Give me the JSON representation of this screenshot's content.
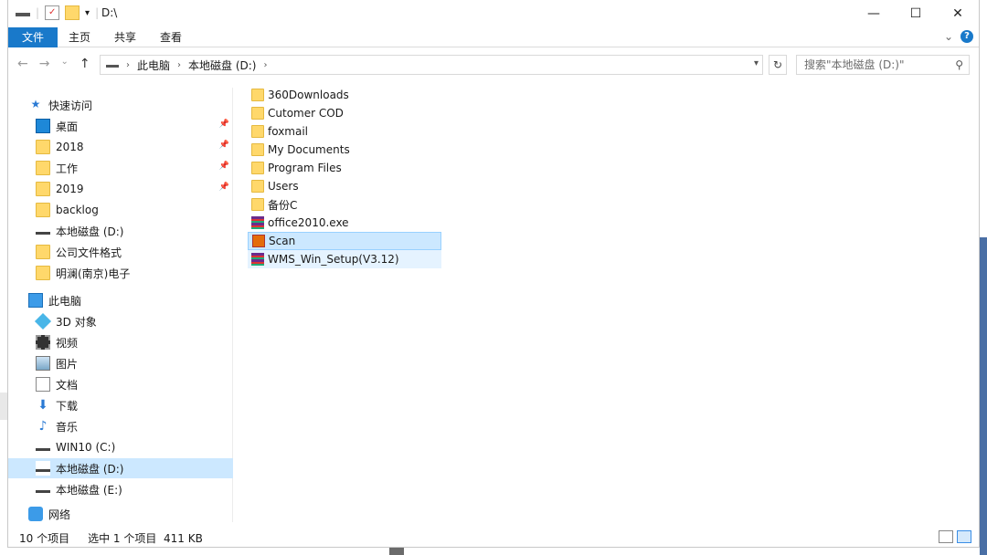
{
  "titlebar": {
    "path_title": "D:\\",
    "controls": {
      "minimize": "—",
      "maximize": "☐",
      "close": "✕"
    }
  },
  "ribbon": {
    "tabs": [
      "文件",
      "主页",
      "共享",
      "查看"
    ],
    "help": "?",
    "expand": "⌄"
  },
  "address": {
    "crumbs": [
      "此电脑",
      "本地磁盘 (D:)"
    ],
    "separator": "›",
    "refresh": "↻"
  },
  "search": {
    "placeholder": "搜索\"本地磁盘 (D:)\""
  },
  "nav_buttons": [
    "←",
    "→",
    "⌄",
    "↑"
  ],
  "sidebar": {
    "quick_access": {
      "label": "快速访问"
    },
    "quick_items": [
      {
        "label": "桌面",
        "icon": "desktop-icon",
        "pinned": true
      },
      {
        "label": "2018",
        "icon": "folder-icon",
        "pinned": true
      },
      {
        "label": "工作",
        "icon": "folder-icon",
        "pinned": true
      },
      {
        "label": "2019",
        "icon": "folder-icon",
        "pinned": true
      },
      {
        "label": "backlog",
        "icon": "folder-icon",
        "pinned": false
      },
      {
        "label": "本地磁盘 (D:)",
        "icon": "drive-icon",
        "pinned": false
      },
      {
        "label": "公司文件格式",
        "icon": "folder-icon",
        "pinned": false
      },
      {
        "label": "明澜(南京)电子",
        "icon": "folder-icon",
        "pinned": false
      }
    ],
    "this_pc": {
      "label": "此电脑"
    },
    "pc_items": [
      {
        "label": "3D 对象",
        "icon": "3d-objects-icon"
      },
      {
        "label": "视频",
        "icon": "video-icon"
      },
      {
        "label": "图片",
        "icon": "pictures-icon"
      },
      {
        "label": "文档",
        "icon": "documents-icon"
      },
      {
        "label": "下载",
        "icon": "downloads-icon"
      },
      {
        "label": "音乐",
        "icon": "music-icon"
      },
      {
        "label": "WIN10 (C:)",
        "icon": "system-drive-icon"
      },
      {
        "label": "本地磁盘 (D:)",
        "icon": "drive-icon",
        "selected": true
      },
      {
        "label": "本地磁盘 (E:)",
        "icon": "drive-icon"
      }
    ],
    "network": {
      "label": "网络"
    }
  },
  "files": [
    {
      "name": "360Downloads",
      "type": "folder"
    },
    {
      "name": "Cutomer COD",
      "type": "folder"
    },
    {
      "name": "foxmail",
      "type": "folder"
    },
    {
      "name": "My Documents",
      "type": "folder"
    },
    {
      "name": "Program Files",
      "type": "folder"
    },
    {
      "name": "Users",
      "type": "folder"
    },
    {
      "name": "备份C",
      "type": "folder"
    },
    {
      "name": "office2010.exe",
      "type": "archive"
    },
    {
      "name": "Scan",
      "type": "pdf",
      "selected": true
    },
    {
      "name": "WMS_Win_Setup(V3.12)",
      "type": "archive",
      "hover": true
    }
  ],
  "status": {
    "count": "10 个项目",
    "selection": "选中 1 个项目",
    "size": "411 KB"
  }
}
